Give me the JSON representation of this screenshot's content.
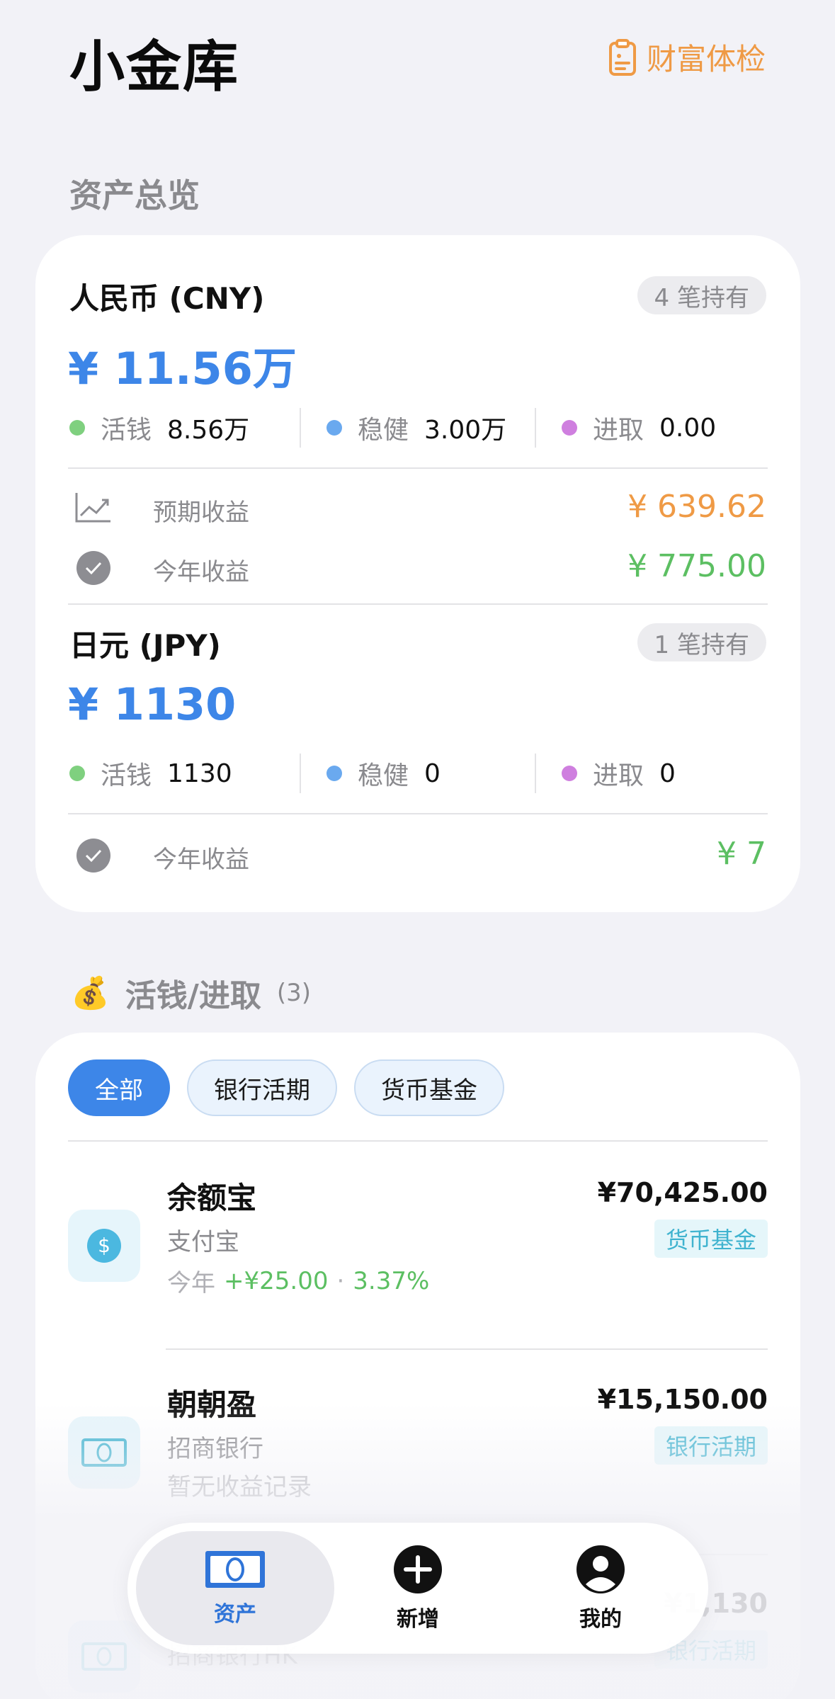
{
  "header": {
    "title": "小金库",
    "checkup_label": "财富体检"
  },
  "overview": {
    "section_title": "资产总览",
    "currencies": [
      {
        "name": "人民币 (CNY)",
        "badge": "4 笔持有",
        "total": "¥ 11.56万",
        "alloc": [
          {
            "label": "活钱",
            "value": "8.56万",
            "color": "#7fd07f"
          },
          {
            "label": "稳健",
            "value": "3.00万",
            "color": "#6aa9ef"
          },
          {
            "label": "进取",
            "value": "0.00",
            "color": "#cf7fdf"
          }
        ],
        "expected_label": "预期收益",
        "expected_value": "¥ 639.62",
        "year_label": "今年收益",
        "year_value": "¥ 775.00"
      },
      {
        "name": "日元 (JPY)",
        "badge": "1 笔持有",
        "total": "¥ 1130",
        "alloc": [
          {
            "label": "活钱",
            "value": "1130",
            "color": "#7fd07f"
          },
          {
            "label": "稳健",
            "value": "0",
            "color": "#6aa9ef"
          },
          {
            "label": "进取",
            "value": "0",
            "color": "#cf7fdf"
          }
        ],
        "year_label": "今年收益",
        "year_value": "¥ 7"
      }
    ]
  },
  "liquid": {
    "section_title": "活钱/进取",
    "count": "(3)",
    "chips": [
      "全部",
      "银行活期",
      "货币基金"
    ],
    "items": [
      {
        "name": "余额宝",
        "provider": "支付宝",
        "amount": "¥70,425.00",
        "tag": "货币基金",
        "stat_prefix": "今年",
        "stat_gain": "+¥25.00",
        "stat_sep": "·",
        "stat_rate": "3.37%"
      },
      {
        "name": "朝朝盈",
        "provider": "招商银行",
        "amount": "¥15,150.00",
        "tag": "银行活期",
        "stat_text": "暂无收益记录"
      },
      {
        "name": "",
        "provider": "招商银行HK",
        "amount": "¥1,130",
        "tag": "银行活期"
      }
    ]
  },
  "tabbar": {
    "tabs": [
      "资产",
      "新增",
      "我的"
    ]
  },
  "colors": {
    "accent": "#3d86e8",
    "orange": "#ef9a45",
    "green": "#5cbf62"
  }
}
